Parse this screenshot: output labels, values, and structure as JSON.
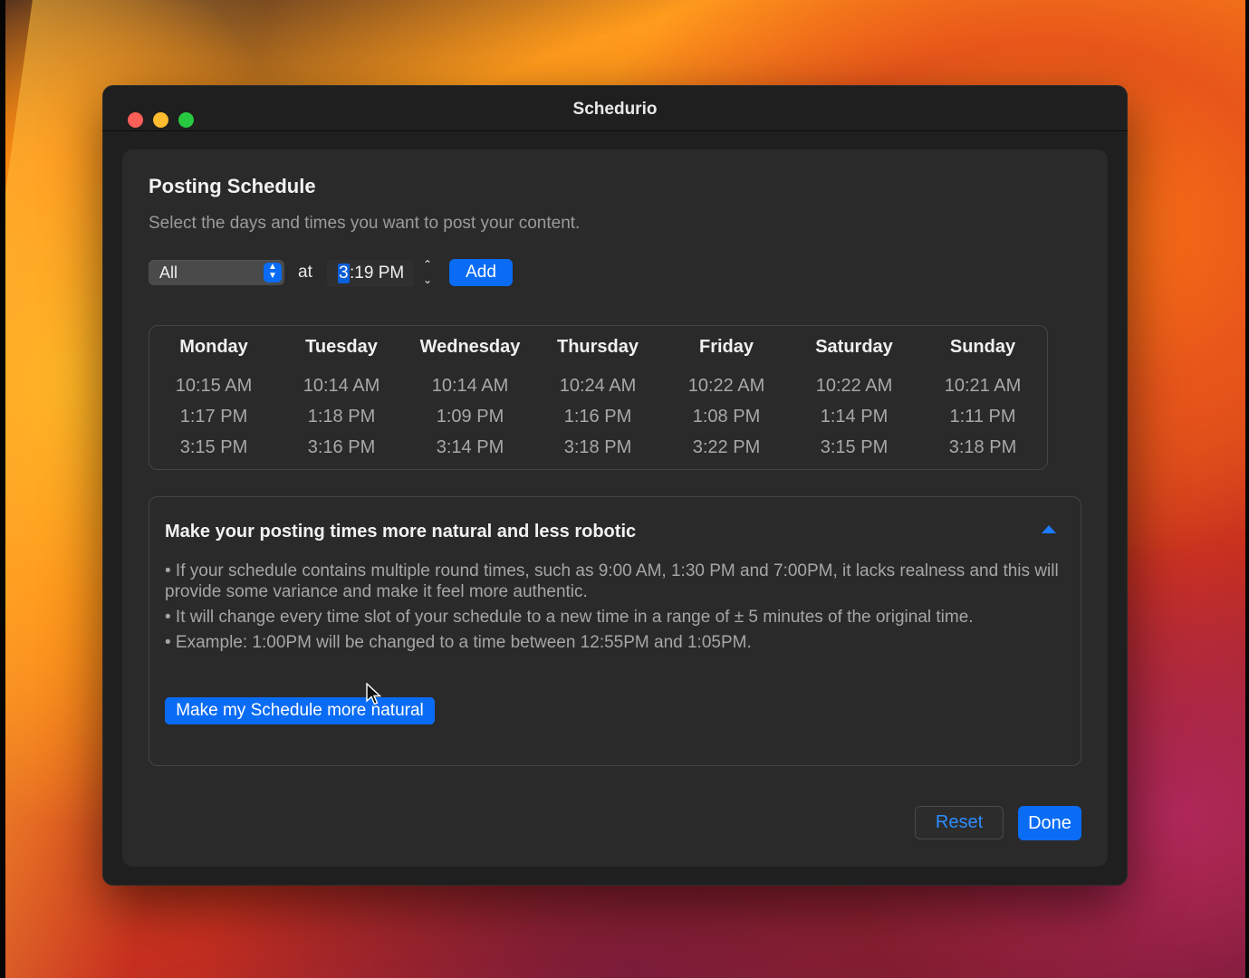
{
  "window": {
    "title": "Schedurio"
  },
  "sheet": {
    "title": "Posting Schedule",
    "subtitle": "Select the days and times you want to post your content."
  },
  "controls": {
    "day_select_value": "All",
    "at_label": "at",
    "time_hour": "3",
    "time_rest": ":19 PM",
    "add_label": "Add"
  },
  "schedule": {
    "days": [
      {
        "name": "Monday",
        "times": [
          "10:15 AM",
          "1:17 PM",
          "3:15 PM"
        ]
      },
      {
        "name": "Tuesday",
        "times": [
          "10:14 AM",
          "1:18 PM",
          "3:16 PM"
        ]
      },
      {
        "name": "Wednesday",
        "times": [
          "10:14 AM",
          "1:09 PM",
          "3:14 PM"
        ]
      },
      {
        "name": "Thursday",
        "times": [
          "10:24 AM",
          "1:16 PM",
          "3:18 PM"
        ]
      },
      {
        "name": "Friday",
        "times": [
          "10:22 AM",
          "1:08 PM",
          "3:22 PM"
        ]
      },
      {
        "name": "Saturday",
        "times": [
          "10:22 AM",
          "1:14 PM",
          "3:15 PM"
        ]
      },
      {
        "name": "Sunday",
        "times": [
          "10:21 AM",
          "1:11 PM",
          "3:18 PM"
        ]
      }
    ]
  },
  "natural": {
    "title": "Make your posting times more natural and less robotic",
    "bullets": [
      "• If your schedule contains multiple round times, such as 9:00 AM, 1:30 PM and 7:00PM, it lacks realness and this will provide some variance and make it feel more authentic.",
      "• It will change every time slot of your schedule to a new time in a range of ± 5 minutes of the original time.",
      "• Example: 1:00PM will be changed to a time between 12:55PM and 1:05PM."
    ],
    "button_label": "Make my Schedule more natural"
  },
  "footer": {
    "reset_label": "Reset",
    "done_label": "Done"
  },
  "colors": {
    "accent": "#0a6cf5",
    "window_bg": "#1f1f1f",
    "sheet_bg": "#2a2a2a"
  },
  "icons": [
    "close-icon",
    "minimize-icon",
    "zoom-icon",
    "select-stepper-icon",
    "time-stepper-icon",
    "collapse-chevron-icon",
    "mouse-pointer-icon"
  ]
}
